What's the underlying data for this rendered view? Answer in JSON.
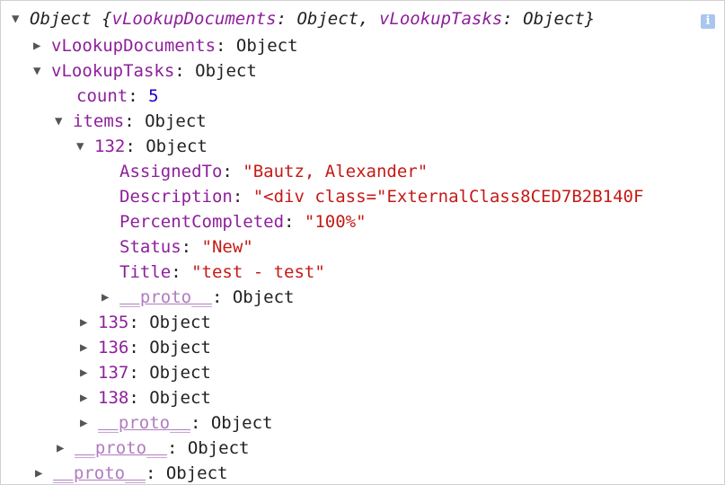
{
  "root": {
    "type": "Object",
    "preview": {
      "open": " {",
      "key1": "vLookupDocuments",
      "val1": "Object",
      "sep": ", ",
      "key2": "vLookupTasks",
      "val2": "Object",
      "close": "}"
    },
    "info_icon": "i"
  },
  "vLookupDocuments": {
    "key": "vLookupDocuments",
    "value": "Object"
  },
  "vLookupTasks": {
    "key": "vLookupTasks",
    "value": "Object",
    "count": {
      "key": "count",
      "value": "5"
    },
    "items": {
      "key": "items",
      "value": "Object",
      "item132": {
        "key": "132",
        "value": "Object",
        "props": [
          {
            "key": "AssignedTo",
            "value": "\"Bautz, Alexander\""
          },
          {
            "key": "Description",
            "value": "\"<div class=\"ExternalClass8CED7B2B140F"
          },
          {
            "key": "PercentCompleted",
            "value": "\"100%\""
          },
          {
            "key": "Status",
            "value": "\"New\""
          },
          {
            "key": "Title",
            "value": "\"test - test\""
          }
        ],
        "proto": {
          "key": "__proto__",
          "value": "Object"
        }
      },
      "collapsed": [
        {
          "key": "135",
          "value": "Object"
        },
        {
          "key": "136",
          "value": "Object"
        },
        {
          "key": "137",
          "value": "Object"
        },
        {
          "key": "138",
          "value": "Object"
        }
      ],
      "proto": {
        "key": "__proto__",
        "value": "Object"
      }
    },
    "proto": {
      "key": "__proto__",
      "value": "Object"
    }
  },
  "root_proto": {
    "key": "__proto__",
    "value": "Object"
  },
  "glyphs": {
    "expanded": "▼",
    "collapsed": "▶",
    "colon": ": "
  }
}
